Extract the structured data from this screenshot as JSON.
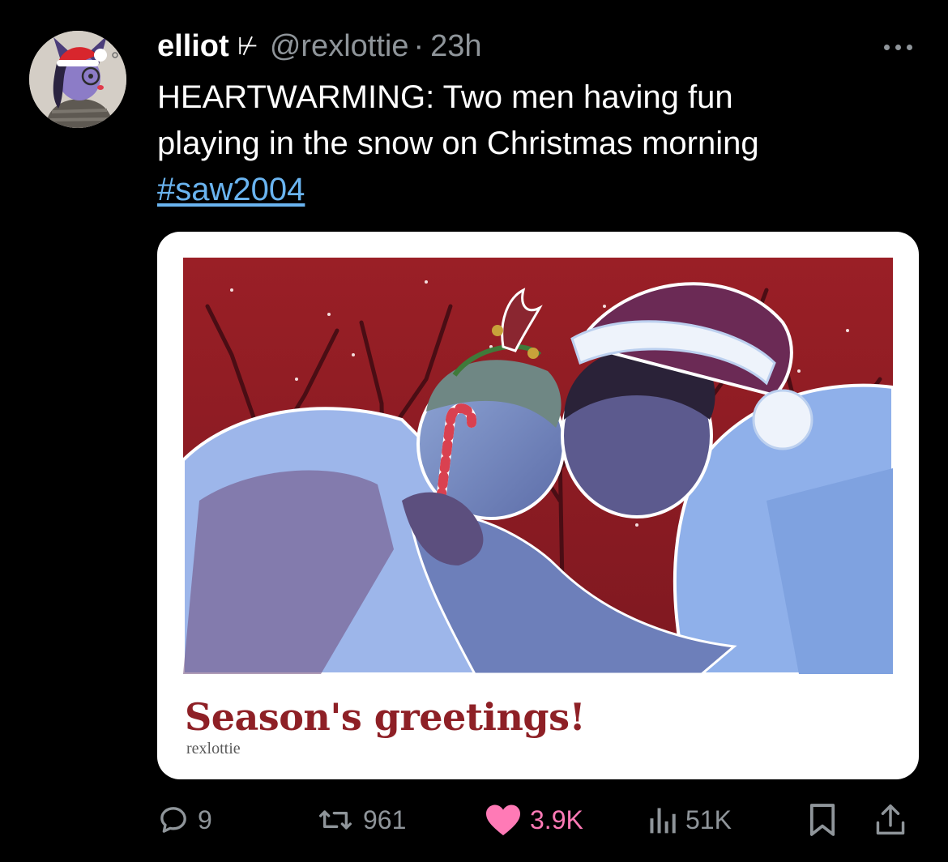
{
  "tweet": {
    "display_name": "elliot",
    "name_glyph": "⊬",
    "handle": "@rexlottie",
    "separator": "·",
    "timestamp": "23h",
    "text_lines": [
      "HEARTWARMING: Two men having fun",
      "playing in the snow on Christmas morning"
    ],
    "hashtag": "#saw2004"
  },
  "media": {
    "title": "Season's greetings!",
    "credit": "rexlottie"
  },
  "actions": {
    "replies": "9",
    "reposts": "961",
    "likes": "3.9K",
    "views": "51K"
  },
  "colors": {
    "background": "#000000",
    "secondary_text": "#8f959a",
    "link": "#6ab4f0",
    "like_active": "#ff7ab6",
    "card_title": "#8e2026"
  },
  "icons": {
    "more": "more-dots-icon",
    "reply": "reply-bubble-icon",
    "repost": "repost-arrows-icon",
    "like": "heart-icon",
    "views": "views-bars-icon",
    "bookmark": "bookmark-icon",
    "share": "share-icon"
  }
}
